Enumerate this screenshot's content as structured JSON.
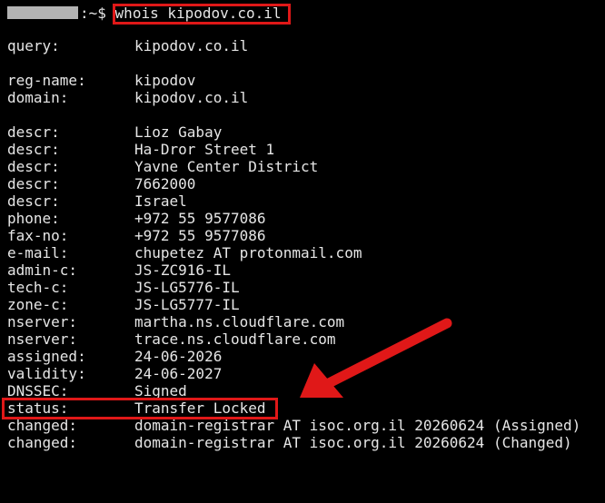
{
  "prompt": {
    "suffix": ":~$",
    "command": "whois kipodov.co.il"
  },
  "records": [
    {
      "key": "query:",
      "value": "kipodov.co.il"
    },
    {
      "key": "reg-name:",
      "value": "kipodov"
    },
    {
      "key": "domain:",
      "value": "kipodov.co.il"
    },
    {
      "key": "descr:",
      "value": "Lioz Gabay"
    },
    {
      "key": "descr:",
      "value": "Ha-Dror Street 1"
    },
    {
      "key": "descr:",
      "value": "Yavne Center District"
    },
    {
      "key": "descr:",
      "value": "7662000"
    },
    {
      "key": "descr:",
      "value": "Israel"
    },
    {
      "key": "phone:",
      "value": "+972 55 9577086"
    },
    {
      "key": "fax-no:",
      "value": "+972 55 9577086"
    },
    {
      "key": "e-mail:",
      "value": "chupetez AT protonmail.com"
    },
    {
      "key": "admin-c:",
      "value": "JS-ZC916-IL"
    },
    {
      "key": "tech-c:",
      "value": "JS-LG5776-IL"
    },
    {
      "key": "zone-c:",
      "value": "JS-LG5777-IL"
    },
    {
      "key": "nserver:",
      "value": "martha.ns.cloudflare.com"
    },
    {
      "key": "nserver:",
      "value": "trace.ns.cloudflare.com"
    },
    {
      "key": "assigned:",
      "value": "24-06-2026"
    },
    {
      "key": "validity:",
      "value": "24-06-2027"
    },
    {
      "key": "DNSSEC:",
      "value": "Signed"
    },
    {
      "key": "status:",
      "value": "Transfer Locked"
    },
    {
      "key": "changed:",
      "value": "domain-registrar AT isoc.org.il 20260624 (Assigned)"
    },
    {
      "key": "changed:",
      "value": "domain-registrar AT isoc.org.il 20260624 (Changed)"
    }
  ],
  "colors": {
    "background": "#000000",
    "text": "#e6e6e6",
    "highlight": "#e01818",
    "redaction": "#b3b3b3"
  },
  "annotations": {
    "arrow_icon": "red-arrow-icon"
  }
}
